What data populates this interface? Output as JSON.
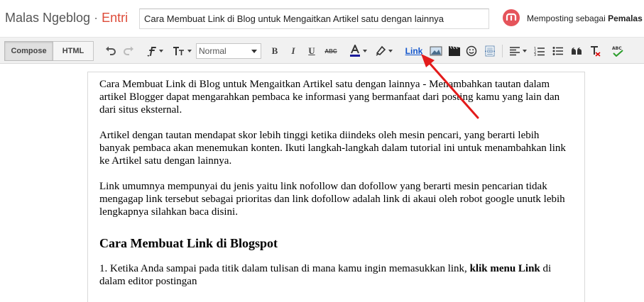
{
  "header": {
    "blog_name": "Malas Ngeblog",
    "separator": "·",
    "section": "Entri",
    "post_title": "Cara Membuat Link di Blog untuk Mengaitkan Artikel satu dengan lainnya",
    "posting_as_prefix": "Memposting sebagai",
    "posting_as_user": "Pemalas"
  },
  "toolbar": {
    "compose_label": "Compose",
    "html_label": "HTML",
    "font_size_value": "Normal",
    "bold_label": "B",
    "italic_label": "I",
    "underline_label": "U",
    "strike_label": "ABC",
    "link_label": "Link"
  },
  "editor": {
    "paragraphs": [
      "Cara Membuat Link di Blog untuk Mengaitkan Artikel satu dengan lainnya - Menambahkan tautan dalam artikel Blogger dapat mengarahkan pembaca  ke informasi yang bermanfaat dari posting kamu yang lain dan dari situs eksternal.",
      "Artikel dengan tautan mendapat skor lebih tinggi ketika diindeks oleh mesin pencari, yang berarti lebih banyak pembaca akan menemukan konten. Ikuti langkah-langkah dalam tutorial ini untuk menambahkan link ke Artikel satu dengan lainnya.",
      "Link umumnya mempunyai du jenis yaitu link nofollow dan dofollow yang berarti mesin pencarian tidak mengagap link tersebut sebagai prioritas dan link dofollow adalah link di akaui oleh robot google unutk lebih lengkapnya silahkan baca disini."
    ],
    "heading": "Cara Membuat Link di Blogspot",
    "step1_prefix": "1. Ketika Anda sampai pada titik dalam tulisan di mana kamu ingin memasukkan link, ",
    "step1_bold": "klik menu Link",
    "step1_suffix": " di dalam editor postingan"
  },
  "colors": {
    "accent": "#dd4b39",
    "link": "#1155cc",
    "arrow": "#e31b1b"
  }
}
